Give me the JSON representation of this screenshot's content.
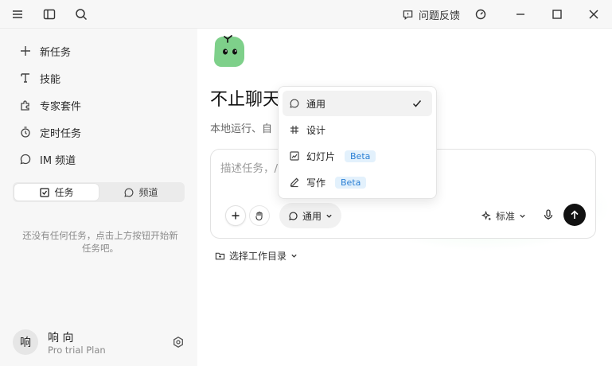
{
  "topbar": {
    "feedback_label": "问题反馈"
  },
  "sidebar": {
    "items": [
      {
        "label": "新任务",
        "icon": "plus-icon"
      },
      {
        "label": "技能",
        "icon": "skill-icon"
      },
      {
        "label": "专家套件",
        "icon": "puzzle-icon"
      },
      {
        "label": "定时任务",
        "icon": "timer-icon"
      },
      {
        "label": "IM 频道",
        "icon": "chat-icon"
      }
    ],
    "tabs": [
      {
        "label": "任务",
        "active": true
      },
      {
        "label": "频道",
        "active": false
      }
    ],
    "empty_message": "还没有任何任务，点击上方按钮开始新任务吧。",
    "user": {
      "avatar_text": "响",
      "name": "响 向",
      "plan": "Pro trial Plan"
    }
  },
  "main": {
    "headline": "不止聊天",
    "subline": "本地运行、自",
    "composer": {
      "placeholder": "描述任务，/                              准模式经济高效",
      "mode_label": "通用",
      "standard_label": "标准"
    },
    "workdir_label": "选择工作目录"
  },
  "dropdown": {
    "items": [
      {
        "label": "通用",
        "icon": "chat-icon",
        "selected": true,
        "badge": ""
      },
      {
        "label": "设计",
        "icon": "hash-icon",
        "selected": false,
        "badge": ""
      },
      {
        "label": "幻灯片",
        "icon": "slides-icon",
        "selected": false,
        "badge": "Beta"
      },
      {
        "label": "写作",
        "icon": "pen-icon",
        "selected": false,
        "badge": "Beta"
      }
    ]
  },
  "colors": {
    "accent": "#111111",
    "mascot_green": "#7ed08a",
    "badge_text": "#2a7fd4",
    "badge_bg": "#e3f1fc"
  }
}
